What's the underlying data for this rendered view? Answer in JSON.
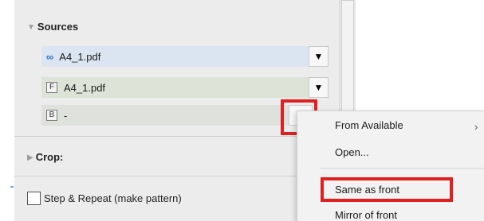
{
  "sources": {
    "header": "Sources",
    "rows": [
      {
        "icon": "link-icon",
        "value": "A4_1.pdf"
      },
      {
        "icon": "front-icon",
        "icon_letter": "F",
        "value": "A4_1.pdf"
      },
      {
        "icon": "back-icon",
        "icon_letter": "B",
        "value": "-"
      }
    ],
    "dropdown_glyph": "▼"
  },
  "crop": {
    "header": "Crop:"
  },
  "step_repeat": {
    "label": "Step & Repeat (make pattern)",
    "checked": false
  },
  "menu": {
    "items": [
      {
        "label": "From Available",
        "has_submenu": true,
        "submenu_glyph": "›"
      },
      {
        "label": "Open..."
      },
      {
        "label": "Same as front",
        "highlighted": true
      },
      {
        "label": "Mirror of front"
      }
    ]
  },
  "colors": {
    "highlight_red": "#e02020",
    "row_link_bg": "#dbe5f1",
    "row_front_bg": "#dde3d6",
    "row_back_bg": "#dfe2dc",
    "panel_bg": "#ececec",
    "menu_bg": "#f2f2f2",
    "link_icon_blue": "#2f73c9"
  }
}
